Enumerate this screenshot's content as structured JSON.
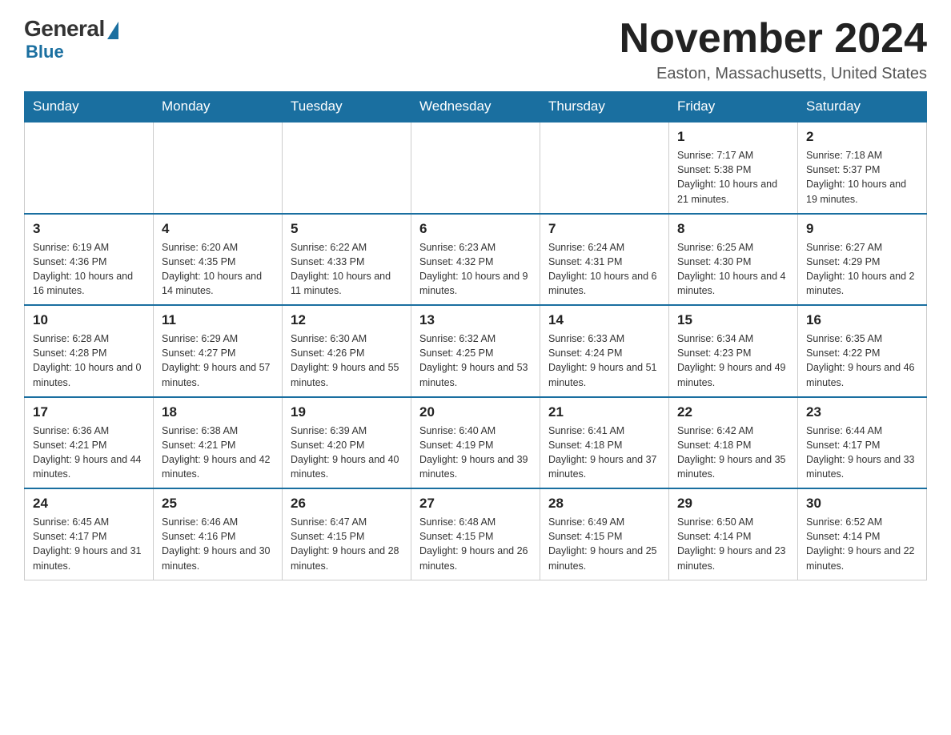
{
  "logo": {
    "general": "General",
    "blue": "Blue"
  },
  "header": {
    "title": "November 2024",
    "location": "Easton, Massachusetts, United States"
  },
  "days_of_week": [
    "Sunday",
    "Monday",
    "Tuesday",
    "Wednesday",
    "Thursday",
    "Friday",
    "Saturday"
  ],
  "weeks": [
    [
      {
        "day": "",
        "info": ""
      },
      {
        "day": "",
        "info": ""
      },
      {
        "day": "",
        "info": ""
      },
      {
        "day": "",
        "info": ""
      },
      {
        "day": "",
        "info": ""
      },
      {
        "day": "1",
        "info": "Sunrise: 7:17 AM\nSunset: 5:38 PM\nDaylight: 10 hours and 21 minutes."
      },
      {
        "day": "2",
        "info": "Sunrise: 7:18 AM\nSunset: 5:37 PM\nDaylight: 10 hours and 19 minutes."
      }
    ],
    [
      {
        "day": "3",
        "info": "Sunrise: 6:19 AM\nSunset: 4:36 PM\nDaylight: 10 hours and 16 minutes."
      },
      {
        "day": "4",
        "info": "Sunrise: 6:20 AM\nSunset: 4:35 PM\nDaylight: 10 hours and 14 minutes."
      },
      {
        "day": "5",
        "info": "Sunrise: 6:22 AM\nSunset: 4:33 PM\nDaylight: 10 hours and 11 minutes."
      },
      {
        "day": "6",
        "info": "Sunrise: 6:23 AM\nSunset: 4:32 PM\nDaylight: 10 hours and 9 minutes."
      },
      {
        "day": "7",
        "info": "Sunrise: 6:24 AM\nSunset: 4:31 PM\nDaylight: 10 hours and 6 minutes."
      },
      {
        "day": "8",
        "info": "Sunrise: 6:25 AM\nSunset: 4:30 PM\nDaylight: 10 hours and 4 minutes."
      },
      {
        "day": "9",
        "info": "Sunrise: 6:27 AM\nSunset: 4:29 PM\nDaylight: 10 hours and 2 minutes."
      }
    ],
    [
      {
        "day": "10",
        "info": "Sunrise: 6:28 AM\nSunset: 4:28 PM\nDaylight: 10 hours and 0 minutes."
      },
      {
        "day": "11",
        "info": "Sunrise: 6:29 AM\nSunset: 4:27 PM\nDaylight: 9 hours and 57 minutes."
      },
      {
        "day": "12",
        "info": "Sunrise: 6:30 AM\nSunset: 4:26 PM\nDaylight: 9 hours and 55 minutes."
      },
      {
        "day": "13",
        "info": "Sunrise: 6:32 AM\nSunset: 4:25 PM\nDaylight: 9 hours and 53 minutes."
      },
      {
        "day": "14",
        "info": "Sunrise: 6:33 AM\nSunset: 4:24 PM\nDaylight: 9 hours and 51 minutes."
      },
      {
        "day": "15",
        "info": "Sunrise: 6:34 AM\nSunset: 4:23 PM\nDaylight: 9 hours and 49 minutes."
      },
      {
        "day": "16",
        "info": "Sunrise: 6:35 AM\nSunset: 4:22 PM\nDaylight: 9 hours and 46 minutes."
      }
    ],
    [
      {
        "day": "17",
        "info": "Sunrise: 6:36 AM\nSunset: 4:21 PM\nDaylight: 9 hours and 44 minutes."
      },
      {
        "day": "18",
        "info": "Sunrise: 6:38 AM\nSunset: 4:21 PM\nDaylight: 9 hours and 42 minutes."
      },
      {
        "day": "19",
        "info": "Sunrise: 6:39 AM\nSunset: 4:20 PM\nDaylight: 9 hours and 40 minutes."
      },
      {
        "day": "20",
        "info": "Sunrise: 6:40 AM\nSunset: 4:19 PM\nDaylight: 9 hours and 39 minutes."
      },
      {
        "day": "21",
        "info": "Sunrise: 6:41 AM\nSunset: 4:18 PM\nDaylight: 9 hours and 37 minutes."
      },
      {
        "day": "22",
        "info": "Sunrise: 6:42 AM\nSunset: 4:18 PM\nDaylight: 9 hours and 35 minutes."
      },
      {
        "day": "23",
        "info": "Sunrise: 6:44 AM\nSunset: 4:17 PM\nDaylight: 9 hours and 33 minutes."
      }
    ],
    [
      {
        "day": "24",
        "info": "Sunrise: 6:45 AM\nSunset: 4:17 PM\nDaylight: 9 hours and 31 minutes."
      },
      {
        "day": "25",
        "info": "Sunrise: 6:46 AM\nSunset: 4:16 PM\nDaylight: 9 hours and 30 minutes."
      },
      {
        "day": "26",
        "info": "Sunrise: 6:47 AM\nSunset: 4:15 PM\nDaylight: 9 hours and 28 minutes."
      },
      {
        "day": "27",
        "info": "Sunrise: 6:48 AM\nSunset: 4:15 PM\nDaylight: 9 hours and 26 minutes."
      },
      {
        "day": "28",
        "info": "Sunrise: 6:49 AM\nSunset: 4:15 PM\nDaylight: 9 hours and 25 minutes."
      },
      {
        "day": "29",
        "info": "Sunrise: 6:50 AM\nSunset: 4:14 PM\nDaylight: 9 hours and 23 minutes."
      },
      {
        "day": "30",
        "info": "Sunrise: 6:52 AM\nSunset: 4:14 PM\nDaylight: 9 hours and 22 minutes."
      }
    ]
  ]
}
